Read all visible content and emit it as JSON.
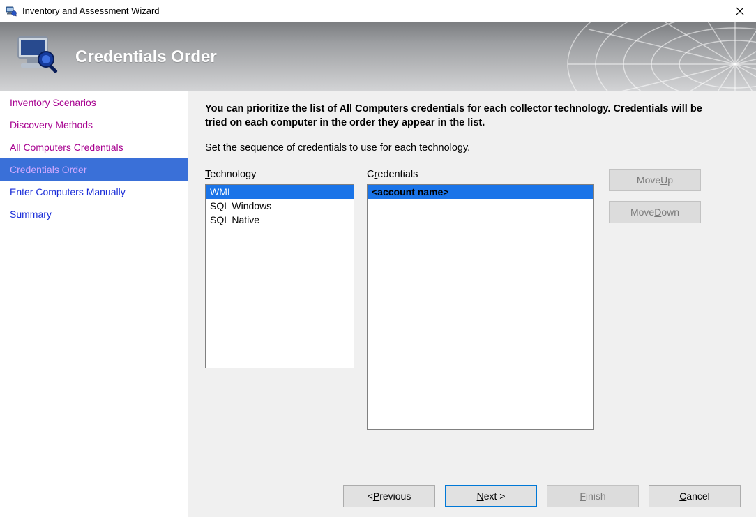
{
  "window": {
    "title": "Inventory and Assessment Wizard"
  },
  "banner": {
    "heading": "Credentials Order"
  },
  "sidebar": {
    "items": [
      {
        "label": "Inventory Scenarios",
        "state": "visited"
      },
      {
        "label": "Discovery Methods",
        "state": "visited"
      },
      {
        "label": "All Computers Credentials",
        "state": "visited"
      },
      {
        "label": "Credentials Order",
        "state": "active"
      },
      {
        "label": "Enter Computers Manually",
        "state": ""
      },
      {
        "label": "Summary",
        "state": ""
      }
    ]
  },
  "main": {
    "intro": "You can prioritize the list of All Computers credentials for each collector technology. Credentials will be tried on each computer in the order they appear in the list.",
    "subintro": "Set the sequence of credentials to use for each technology.",
    "technology": {
      "label_pre": "T",
      "label_u": "",
      "label_rest": "echnology",
      "items": [
        {
          "label": "WMI",
          "selected": true
        },
        {
          "label": "SQL Windows",
          "selected": false
        },
        {
          "label": "SQL Native",
          "selected": false
        }
      ]
    },
    "credentials": {
      "label_pre": "C",
      "label_u": "r",
      "label_rest": "edentials",
      "items": [
        {
          "label": "<account name>",
          "selected": true
        }
      ]
    },
    "moveup": {
      "pre": "Move ",
      "u": "U",
      "rest": "p",
      "enabled": false
    },
    "movedown": {
      "pre": "Move ",
      "u": "D",
      "rest": "own",
      "enabled": false
    }
  },
  "footer": {
    "previous": {
      "pre": "< ",
      "u": "P",
      "rest": "revious",
      "enabled": true,
      "default": false
    },
    "next": {
      "pre": "",
      "u": "N",
      "rest": "ext >",
      "enabled": true,
      "default": true
    },
    "finish": {
      "pre": "",
      "u": "F",
      "rest": "inish",
      "enabled": false,
      "default": false
    },
    "cancel": {
      "pre": "",
      "u": "C",
      "rest": "ancel",
      "enabled": true,
      "default": false
    }
  }
}
